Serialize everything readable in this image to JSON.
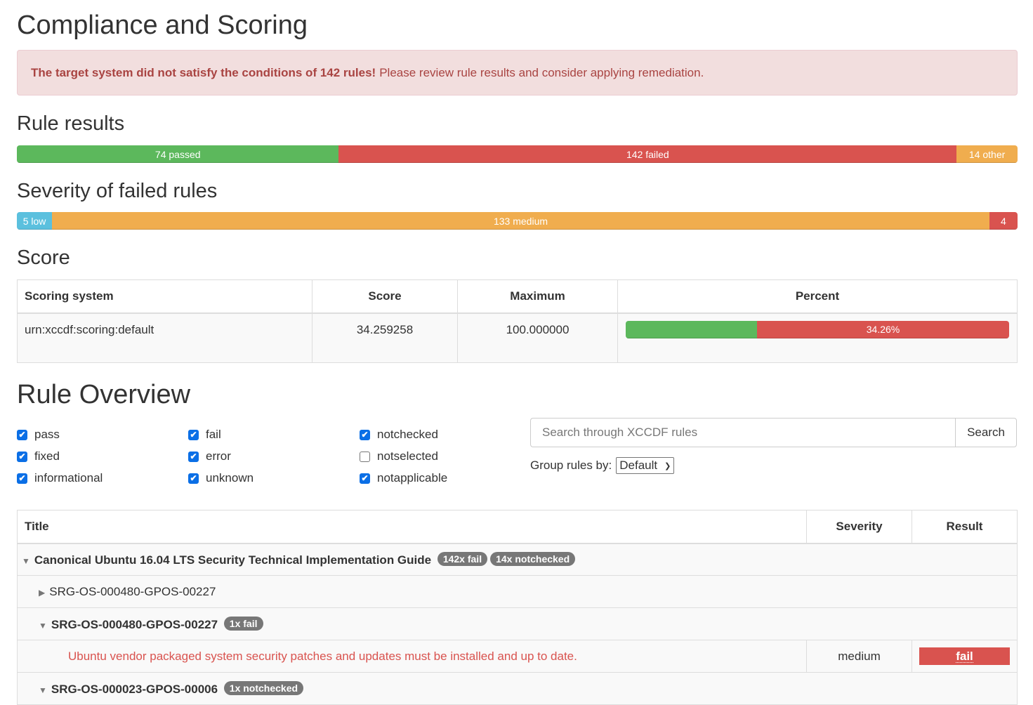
{
  "heading": "Compliance and Scoring",
  "alert": {
    "bold": "The target system did not satisfy the conditions of 142 rules!",
    "text": "Please review rule results and consider applying remediation."
  },
  "rule_results": {
    "title": "Rule results",
    "segments": [
      {
        "label": "74 passed",
        "count": 74,
        "color": "#5cb85c"
      },
      {
        "label": "142 failed",
        "count": 142,
        "color": "#d9534f"
      },
      {
        "label": "14 other",
        "count": 14,
        "color": "#f0ad4e"
      }
    ]
  },
  "severity": {
    "title": "Severity of failed rules",
    "segments": [
      {
        "label": "5 low",
        "count": 5,
        "color": "#5bc0de"
      },
      {
        "label": "133 medium",
        "count": 133,
        "color": "#f0ad4e"
      },
      {
        "label": "4",
        "count": 4,
        "color": "#d9534f"
      }
    ]
  },
  "score": {
    "title": "Score",
    "headers": [
      "Scoring system",
      "Score",
      "Maximum",
      "Percent"
    ],
    "row": {
      "system": "urn:xccdf:scoring:default",
      "score": "34.259258",
      "maximum": "100.000000",
      "percent_label": "34.26%",
      "percent_value": 34.26
    },
    "colors": {
      "pass": "#5cb85c",
      "fail": "#d9534f"
    }
  },
  "overview": {
    "title": "Rule Overview",
    "filters": [
      {
        "label": "pass",
        "checked": true
      },
      {
        "label": "fixed",
        "checked": true
      },
      {
        "label": "informational",
        "checked": true
      },
      {
        "label": "fail",
        "checked": true
      },
      {
        "label": "error",
        "checked": true
      },
      {
        "label": "unknown",
        "checked": true
      },
      {
        "label": "notchecked",
        "checked": true
      },
      {
        "label": "notselected",
        "checked": false
      },
      {
        "label": "notapplicable",
        "checked": true
      }
    ],
    "search_placeholder": "Search through XCCDF rules",
    "search_button": "Search",
    "group_label": "Group rules by:",
    "group_value": "Default"
  },
  "rules_table": {
    "headers": [
      "Title",
      "Severity",
      "Result"
    ],
    "group": {
      "title": "Canonical Ubuntu 16.04 LTS Security Technical Implementation Guide",
      "badges": [
        "142x fail",
        "14x notchecked"
      ]
    },
    "rows": [
      {
        "title": "SRG-OS-000480-GPOS-00227",
        "expanded": false,
        "badges": []
      },
      {
        "title": "SRG-OS-000480-GPOS-00227",
        "expanded": true,
        "badges": [
          "1x fail"
        ]
      },
      {
        "rule": "Ubuntu vendor packaged system security patches and updates must be installed and up to date.",
        "severity": "medium",
        "result": "fail"
      },
      {
        "title": "SRG-OS-000023-GPOS-00006",
        "expanded": true,
        "badges": [
          "1x notchecked"
        ]
      }
    ]
  }
}
